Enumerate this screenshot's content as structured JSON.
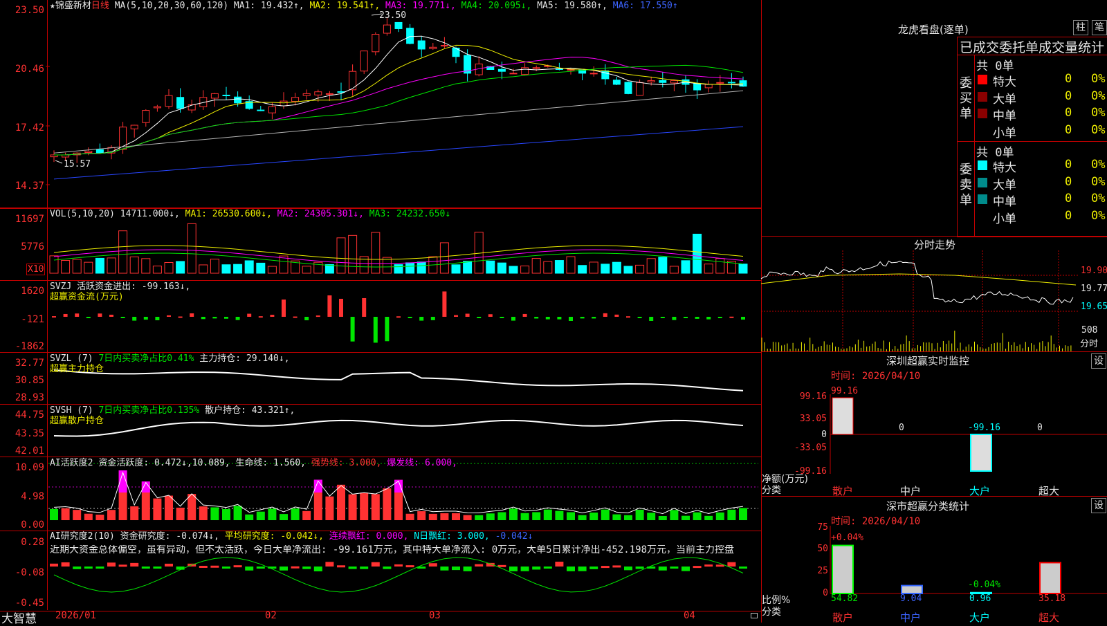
{
  "colors": {
    "up": "#ff3232",
    "down": "#00ffff",
    "ma1": "#ffffff",
    "ma2": "#f0f000",
    "ma3": "#ff00ff",
    "ma4": "#00e600",
    "ma5": "#b4b4b4",
    "ma6": "#2846ff",
    "frame": "#c00000"
  },
  "main": {
    "star": "★",
    "stock": "锦盛新材",
    "period": "日线",
    "ma_label": "MA(5,10,20,30,60,120)",
    "ma1": "MA1: 19.432↑,",
    "ma2": "MA2: 19.541↑,",
    "ma3": "MA3: 19.771↓,",
    "ma4": "MA4: 20.095↓,",
    "ma5": "MA5: 19.580↑,",
    "ma6": "MA6: 17.550↑",
    "ticks": [
      "23.50",
      "20.46",
      "17.42",
      "14.37"
    ],
    "high_label": "23.50",
    "low_label": "15.57"
  },
  "vol": {
    "label": "VOL(5,10,20)",
    "val": "14711.000↓,",
    "ma1": "MA1: 26530.600↓,",
    "ma2": "MA2: 24305.301↓,",
    "ma3": "MA3: 24232.650↓",
    "ticks": [
      "11697",
      "5776"
    ],
    "unit": "X10"
  },
  "svzj": {
    "label": "SVZJ",
    "sub": "活跃资金进出: -99.163↓,",
    "title": "超赢资金流(万元)",
    "ticks": [
      "1620",
      "-121",
      "-1862"
    ]
  },
  "svzl": {
    "label": "SVZL (7)",
    "sub": "7日内买卖净占比0.41%",
    "extra": "主力持仓: 29.140↓,",
    "title": "超赢主力持仓",
    "ticks": [
      "32.77",
      "30.85",
      "28.93"
    ]
  },
  "svsh": {
    "label": "SVSH (7)",
    "sub": "7日内买卖净占比0.135%",
    "extra": "散户持仓: 43.321↑,",
    "title": "超赢散户持仓",
    "ticks": [
      "44.75",
      "43.35",
      "42.01"
    ]
  },
  "ai2": {
    "label": "AI活跃度2",
    "a": "资金活跃度: 0.472↓,",
    "b": "10.089,",
    "c": "生命线: 1.560,",
    "d": "强势线: 3.000,",
    "e": "爆发线: 6.000,",
    "ticks": [
      "10.09",
      "4.98",
      "0.00"
    ]
  },
  "air": {
    "label": "AI研究度2(10)",
    "a": "资金研究度: -0.074↓,",
    "b": "平均研究度: -0.042↓,",
    "c": "连续飘红: 0.000,",
    "d": "N日飘红: 3.000,",
    "e": "-0.042↓",
    "desc": "近期大资金总体偏空，虽有异动，但不太活跃，今日大单净流出: -99.161万元，其中特大单净流入: 0万元，大单5日累计净出-452.198万元，当前主力控盘",
    "ticks": [
      "0.28",
      "-0.08",
      "-0.45"
    ]
  },
  "bottom": {
    "logo": "大智慧",
    "dates": [
      "2026/01",
      "02",
      "03",
      "04"
    ]
  },
  "side": {
    "title": "龙虎看盘(逐单)",
    "btn1": "柱",
    "btn2": "笔",
    "header": "已成交委托单成交量统计",
    "buy": {
      "vlabel": "委买单",
      "total": "共 0单",
      "rows": [
        {
          "name": "特大",
          "n": "0",
          "p": "0%"
        },
        {
          "name": "大单",
          "n": "0",
          "p": "0%"
        },
        {
          "name": "中单",
          "n": "0",
          "p": "0%"
        },
        {
          "name": "小单",
          "n": "0",
          "p": "0%"
        }
      ]
    },
    "sell": {
      "vlabel": "委卖单",
      "total": "共 0单",
      "rows": [
        {
          "name": "特大",
          "n": "0",
          "p": "0%"
        },
        {
          "name": "大单",
          "n": "0",
          "p": "0%"
        },
        {
          "name": "中单",
          "n": "0",
          "p": "0%"
        },
        {
          "name": "小单",
          "n": "0",
          "p": "0%"
        }
      ]
    },
    "fenshi": {
      "title": "分时走势",
      "p1": "19.90",
      "p2": "19.77",
      "p3": "19.65",
      "vol": "508",
      "unit": "分时"
    },
    "monitor": {
      "title": "深圳超赢实时监控",
      "btn": "设",
      "time": "时间: 2026/04/10",
      "ticks": [
        "99.16",
        "33.05",
        "0",
        "-33.05",
        "-99.16"
      ],
      "top": "99.16",
      "vals": [
        "0",
        "-99.16",
        "0"
      ],
      "ylabel": "净额(万元)",
      "xlabel": "分类",
      "cats": [
        "散户",
        "中户",
        "大户",
        "超大"
      ]
    },
    "stats": {
      "title": "深市超赢分类统计",
      "btn": "设",
      "time": "时间: 2026/04/10",
      "ticks": [
        "75",
        "50",
        "25",
        "0"
      ],
      "top": "+0.04%",
      "mid": "-0.04%",
      "ylabel": "比例%",
      "xlabel": "分类",
      "vals": [
        "54.82",
        "9.04",
        "0.96",
        "35.18"
      ],
      "cats": [
        "散户",
        "中户",
        "大户",
        "超大"
      ]
    }
  }
}
